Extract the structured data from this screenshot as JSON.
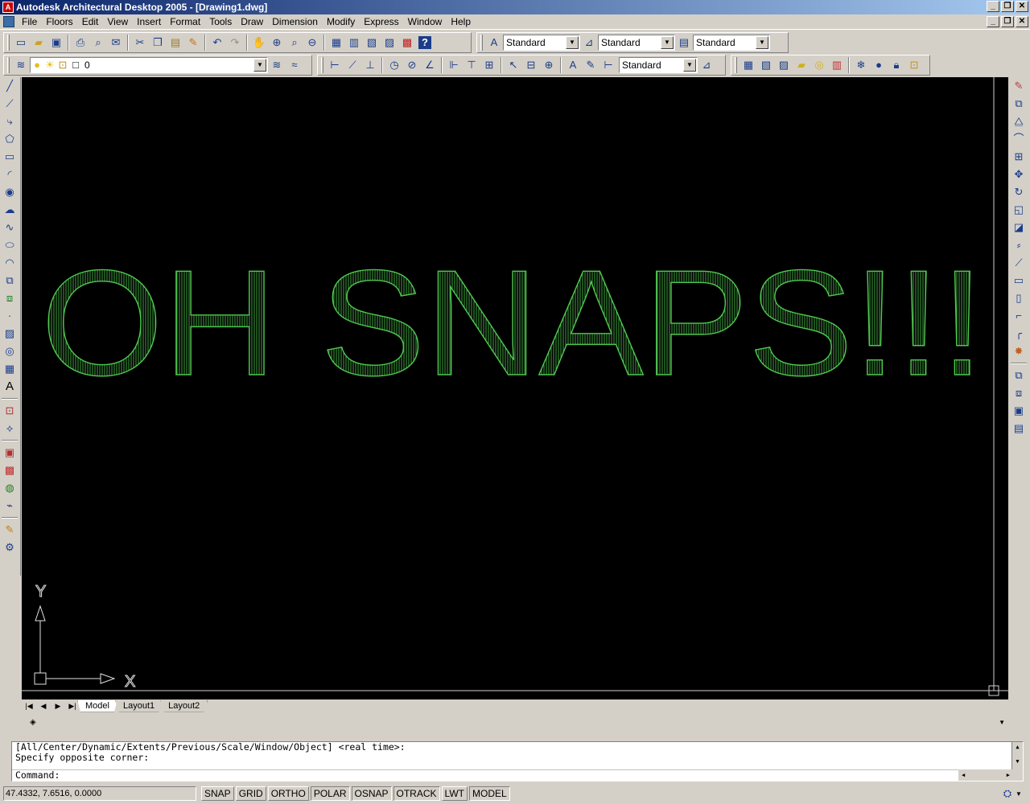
{
  "window": {
    "title": "Autodesk Architectural Desktop 2005 - [Drawing1.dwg]"
  },
  "menu": [
    "File",
    "Floors",
    "Edit",
    "View",
    "Insert",
    "Format",
    "Tools",
    "Draw",
    "Dimension",
    "Modify",
    "Express",
    "Window",
    "Help"
  ],
  "styles": {
    "text_style": "Standard",
    "dim_style": "Standard",
    "table_style": "Standard",
    "dim_style2": "Standard"
  },
  "layer": {
    "current": "0"
  },
  "drawing": {
    "text": "OH SNAPS!!!",
    "color": "#4fc84f",
    "ucs_x": "X",
    "ucs_y": "Y"
  },
  "tabs": [
    "Model",
    "Layout1",
    "Layout2"
  ],
  "command": {
    "line1": "[All/Center/Dynamic/Extents/Previous/Scale/Window/Object] <real time>:",
    "line2": "Specify opposite corner:",
    "prompt": "Command:"
  },
  "status": {
    "coords": "47.4332, 7.6516, 0.0000",
    "buttons": [
      "SNAP",
      "GRID",
      "ORTHO",
      "POLAR",
      "OSNAP",
      "OTRACK",
      "LWT",
      "MODEL"
    ]
  },
  "colors": {
    "canvas": "#000000",
    "text": "#4fc84f",
    "chrome": "#d4d0c8",
    "titlebar": "#0a246a"
  }
}
